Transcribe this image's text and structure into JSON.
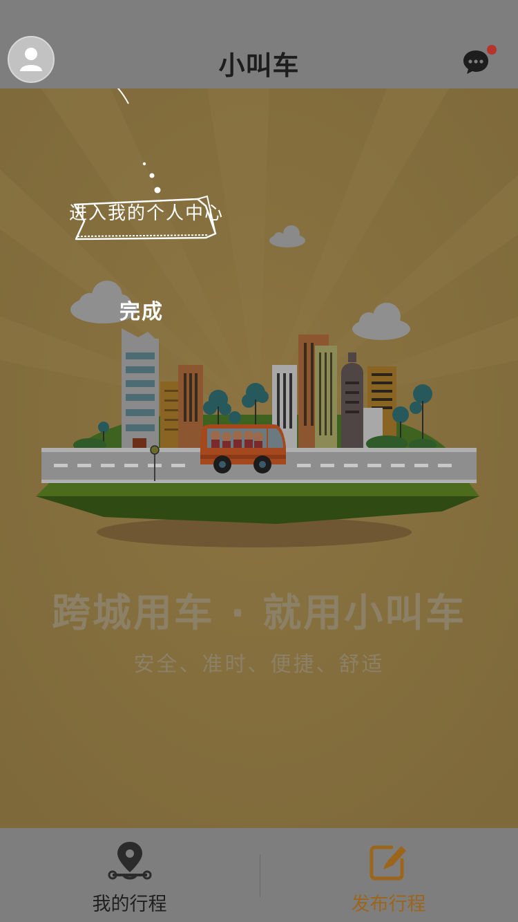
{
  "header": {
    "title": "小叫车",
    "avatar_icon": "user-icon",
    "message_icon": "chat-bubble-icon",
    "has_unread": true
  },
  "guide": {
    "hint": "进入我的个人中心",
    "done_label": "完成"
  },
  "hero": {
    "slogan": "跨城用车 · 就用小叫车",
    "sub_slogan": "安全、准时、便捷、舒适",
    "illustration": "city-bus-illustration"
  },
  "tabbar": {
    "items": [
      {
        "label": "我的行程",
        "icon": "location-route-icon",
        "active": false
      },
      {
        "label": "发布行程",
        "icon": "edit-icon",
        "active": true
      }
    ]
  },
  "colors": {
    "overlay_bg": "#7f6a3c",
    "bar_bg": "#7e7e7e",
    "accent": "#9c651c",
    "unread_dot": "#b8332c"
  }
}
